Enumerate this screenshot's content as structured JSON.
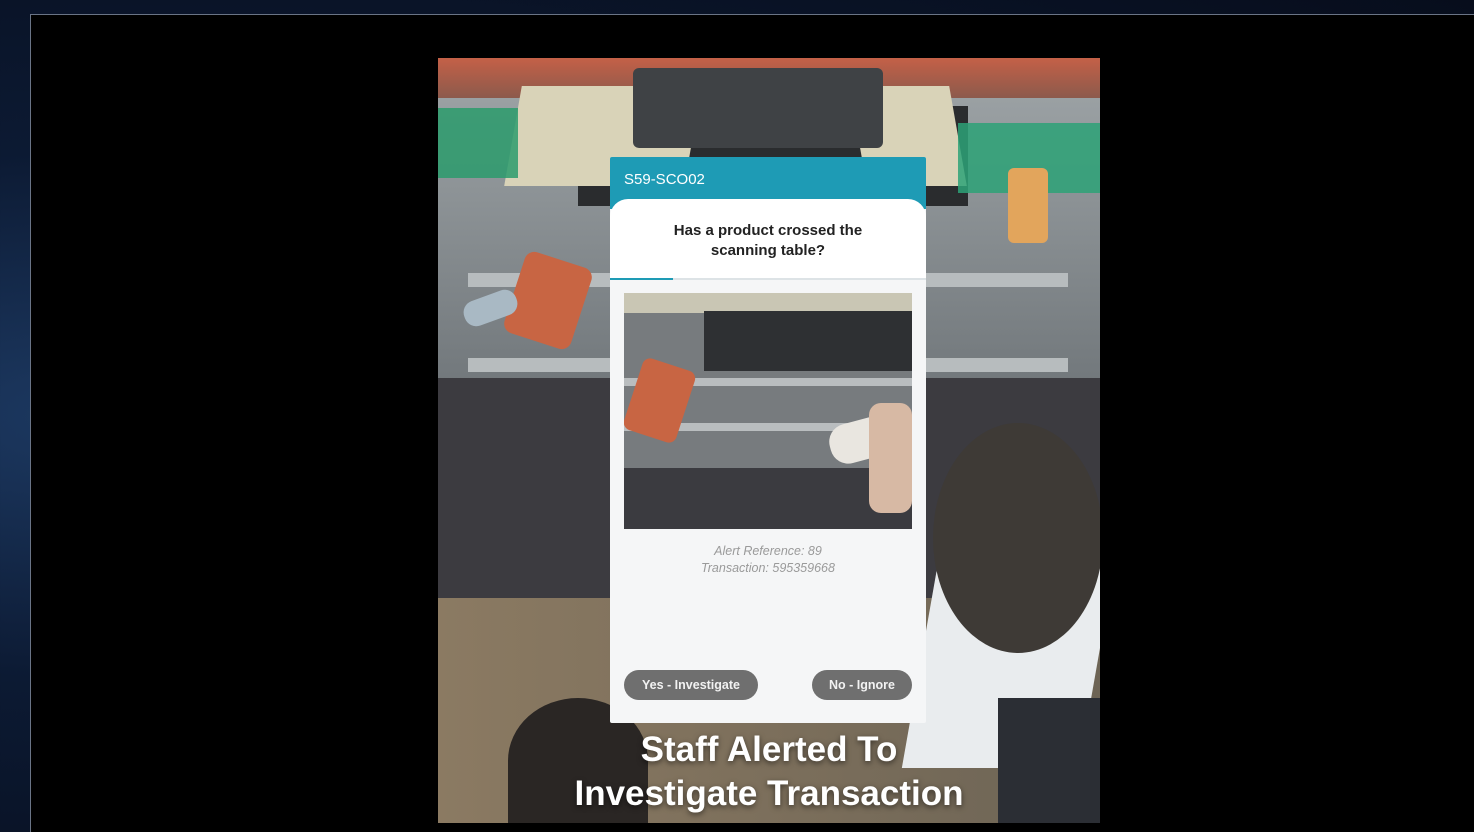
{
  "alert": {
    "station_id": "S59-SCO02",
    "question": "Has a product crossed the scanning table?",
    "progress_fraction": 0.2,
    "reference_line": "Alert Reference: 89",
    "transaction_line": "Transaction: 595359668",
    "yes_button": "Yes - Investigate",
    "no_button": "No - Ignore"
  },
  "caption": {
    "line1": "Staff Alerted To",
    "line2": "Investigate Transaction"
  },
  "colors": {
    "header": "#1e9bb5",
    "button": "#6f6f6f",
    "caption": "#ffffff"
  }
}
